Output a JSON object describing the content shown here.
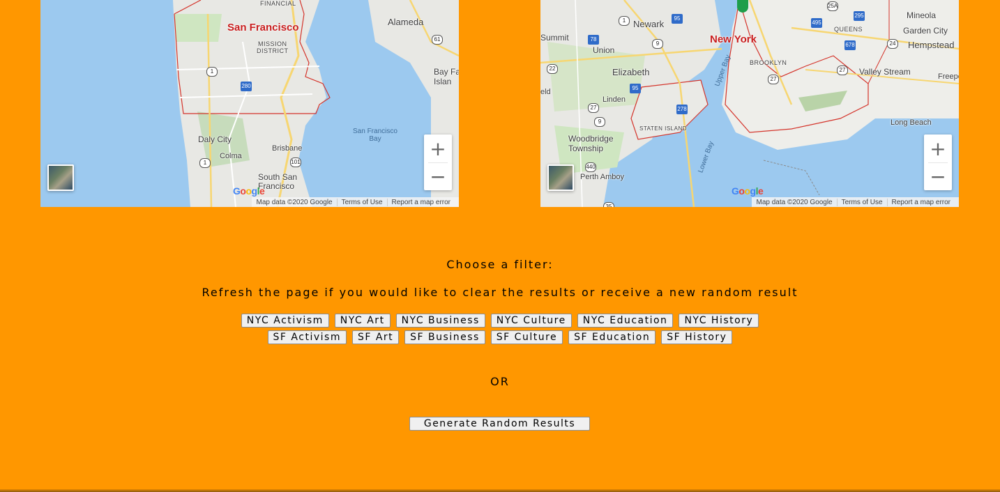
{
  "maps": {
    "sf": {
      "city_label": "San Francisco",
      "labels": {
        "alameda": "Alameda",
        "mission": "MISSION\nDISTRICT",
        "daly_city": "Daly City",
        "colma": "Colma",
        "brisbane": "Brisbane",
        "south_sf": "South San\nFrancisco",
        "sf_bay": "San Francisco\nBay",
        "bay_farm": "Bay Fa\nIslan",
        "financial": "FINANCIAL"
      },
      "shields": [
        "1",
        "280",
        "61",
        "101",
        "1"
      ],
      "google": "Google",
      "attribution": [
        "Map data ©2020 Google",
        "Terms of Use",
        "Report a map error"
      ]
    },
    "nyc": {
      "city_label": "New York",
      "labels": {
        "newark": "Newark",
        "summit": "Summit",
        "union": "Union",
        "elizabeth": "Elizabeth",
        "linden": "Linden",
        "woodbridge": "Woodbridge\nTownship",
        "perth_amboy": "Perth Amboy",
        "staten_island": "STATEN ISLAND",
        "brooklyn": "BROOKLYN",
        "queens": "QUEENS",
        "mineola": "Mineola",
        "garden_city": "Garden City",
        "hempstead": "Hempstead",
        "valley_stream": "Valley Stream",
        "long_beach": "Long Beach",
        "freeport": "Freepo",
        "upper_bay": "Upper Bay",
        "lower_bay": "Lower Bay",
        "eld": "eld"
      },
      "shields": [
        "95",
        "78",
        "9",
        "22",
        "95",
        "1",
        "27",
        "278",
        "440",
        "495",
        "678",
        "295",
        "25A",
        "24",
        "27",
        "27",
        "9",
        "35"
      ],
      "google": "Google",
      "attribution": [
        "Map data ©2020 Google",
        "Terms of Use",
        "Report a map error"
      ]
    },
    "zoom_in_label": "+",
    "zoom_out_label": "−"
  },
  "filters": {
    "choose_label": "Choose a filter:",
    "refresh_note": "Refresh the page if you would like to clear the results or receive a new random result",
    "nyc_buttons": [
      "NYC Activism",
      "NYC Art",
      "NYC Business",
      "NYC Culture",
      "NYC Education",
      "NYC History"
    ],
    "sf_buttons": [
      "SF Activism",
      "SF Art",
      "SF Business",
      "SF Culture",
      "SF Education",
      "SF History"
    ],
    "or_label": "OR",
    "random_button": "Generate Random Results"
  }
}
